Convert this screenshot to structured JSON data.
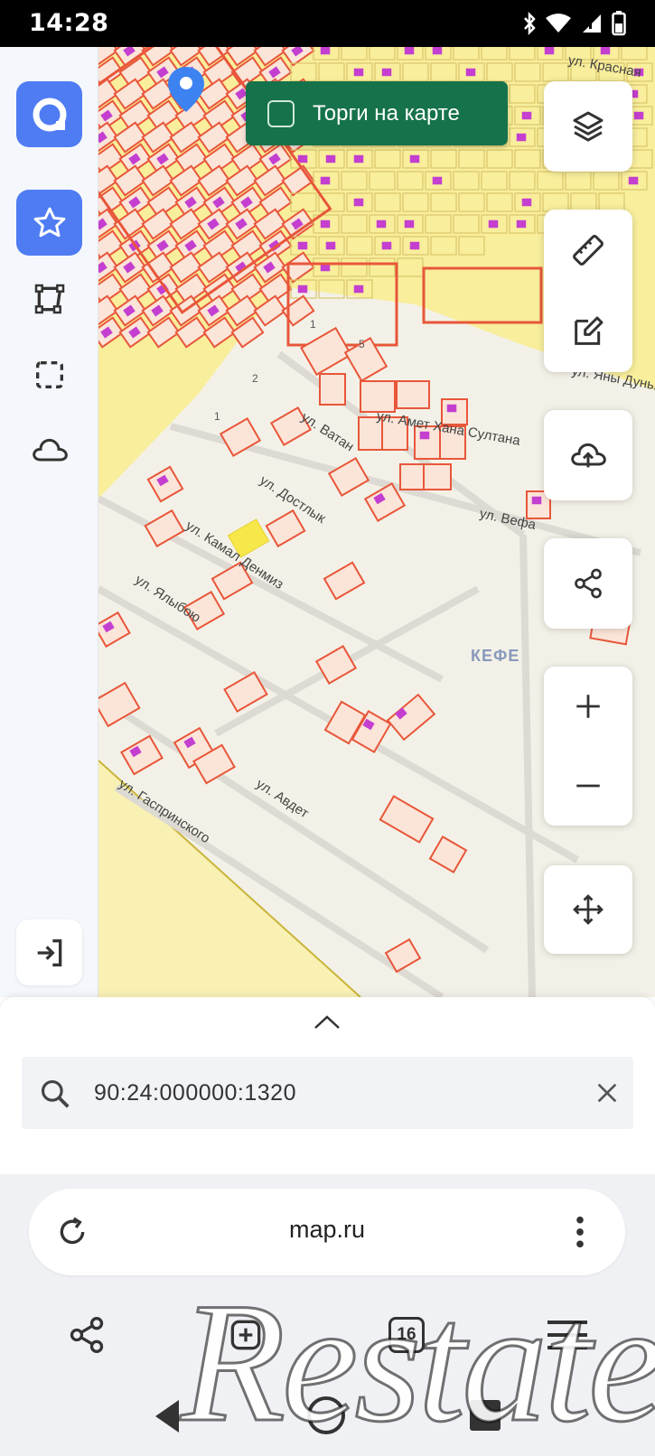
{
  "status_bar": {
    "time": "14:28",
    "icons": [
      "bluetooth-icon",
      "wifi-icon",
      "signal-icon",
      "battery-icon"
    ]
  },
  "sidebar": {
    "logo": "app-logo",
    "items": [
      {
        "icon": "star-icon",
        "active": true
      },
      {
        "icon": "polygon-select-icon",
        "active": false
      },
      {
        "icon": "rectangle-select-icon",
        "active": false
      },
      {
        "icon": "cloud-icon",
        "active": false
      }
    ],
    "bottom_icon": "login-icon"
  },
  "map": {
    "torgi_toggle_label": "Торги на карте",
    "torgi_checked": false,
    "streets": {
      "vatan": "ул. Ватан",
      "amet_khan_sultan": "ул. Амет Хана Султана",
      "dostlyk": "ул. Достлык",
      "vefa": "ул. Вефа",
      "kamal_denmiz": "ул. Камал Денмиз",
      "yalyboyu": "ул. Ялыбою",
      "avdet": "ул. Авдет",
      "gasprinskogo": "ул. Гаспринского",
      "yany_dunya": "ул. Яны Дунья",
      "krasnaya": "ул. Красная"
    },
    "city_label": "КЕФЕ",
    "plot_numbers": [
      "1",
      "1",
      "2",
      "5"
    ],
    "colors": {
      "parcel_border": "#e8563a",
      "parcel_fill": "#fbe4d8",
      "building": "#c43fd0",
      "zone_yellow": "#f8ee9c",
      "background": "#f3f1e7",
      "highlight": "#f6e84a",
      "torgi_green": "#16724a",
      "accent_blue": "#4f7cf3"
    }
  },
  "right_tools": {
    "layers": "layers-icon",
    "ruler": "ruler-icon",
    "edit": "edit-icon",
    "upload": "cloud-upload-icon",
    "share": "share-icon",
    "zoom_in": "plus-icon",
    "zoom_out": "minus-icon",
    "move": "move-icon"
  },
  "search": {
    "value": "90:24:000000:1320",
    "placeholder": ""
  },
  "browser": {
    "url": "map.ru",
    "tab_count": "16"
  },
  "watermark": "Restate"
}
